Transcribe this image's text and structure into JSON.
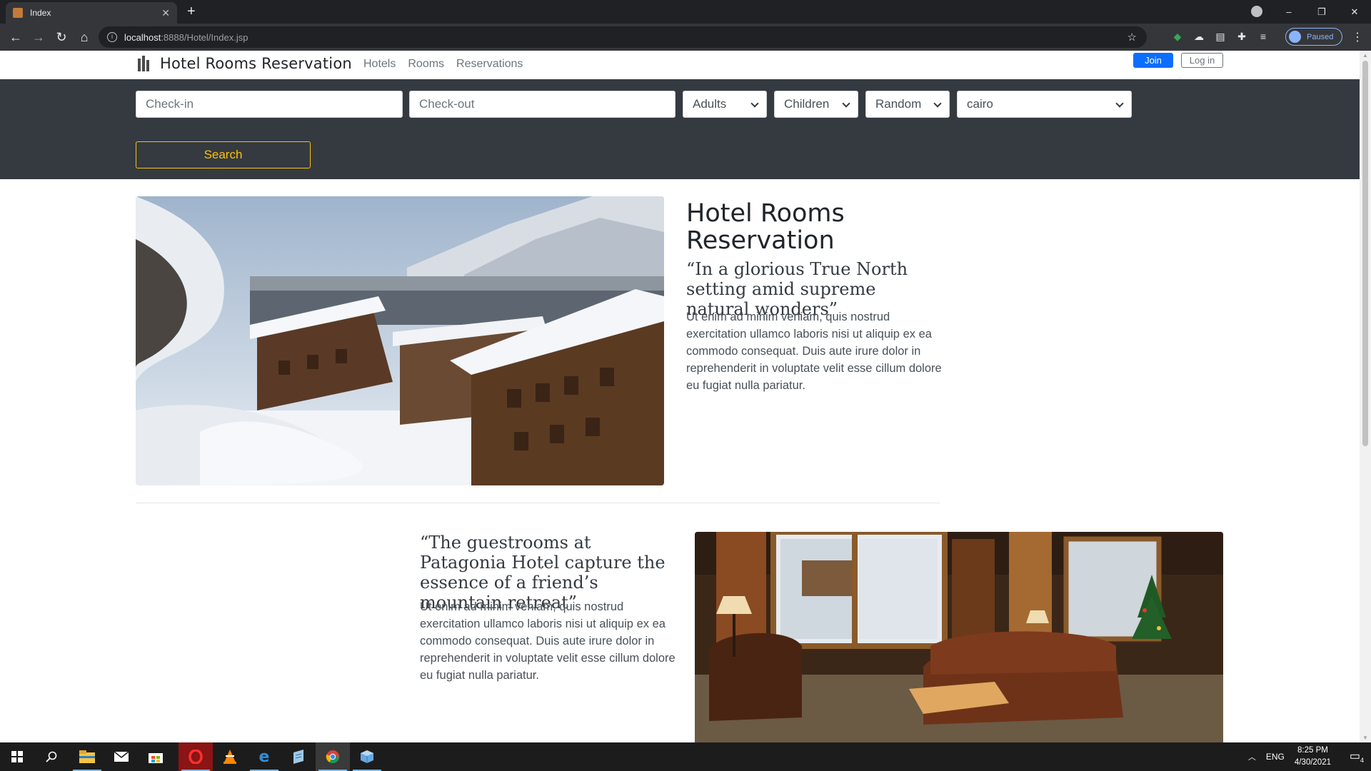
{
  "browser": {
    "tab_title": "Index",
    "new_tab": "+",
    "close_tab": "✕",
    "url_host": "localhost",
    "url_rest": ":8888/Hotel/Index.jsp",
    "profile_status": "Paused",
    "window_controls": {
      "minimize": "–",
      "restore": "❐",
      "close": "✕"
    },
    "nav": {
      "back": "←",
      "forward": "→",
      "reload": "↻",
      "home": "⌂"
    }
  },
  "site": {
    "brand": "Hotel Rooms Reservation",
    "nav_links": [
      "Hotels",
      "Rooms",
      "Reservations"
    ],
    "join_label": "Join",
    "login_label": "Log in"
  },
  "search": {
    "checkin_placeholder": "Check-in",
    "checkout_placeholder": "Check-out",
    "adults": "Adults",
    "children": "Children",
    "sort": "Random",
    "city": "cairo",
    "button": "Search"
  },
  "features": [
    {
      "title": "Hotel Rooms Reservation",
      "quote": "“In a glorious True North setting amid supreme natural wonders”",
      "body": "Ut enim ad minim veniam, quis nostrud exercitation ullamco laboris nisi ut aliquip ex ea commodo consequat. Duis aute irure dolor in reprehenderit in voluptate velit esse cillum dolore eu fugiat nulla pariatur.",
      "image": "snowy-alpine-village-photo"
    },
    {
      "quote": "“The guestrooms at Patagonia Hotel capture the essence of a friend’s mountain retreat”",
      "body": "Ut enim ad minim veniam, quis nostrud exercitation ullamco laboris nisi ut aliquip ex ea commodo consequat. Duis aute irure dolor in reprehenderit in voluptate velit esse cillum dolore eu fugiat nulla pariatur.",
      "image": "cabin-living-room-photo"
    }
  ],
  "taskbar": {
    "apps": [
      "windows-start-icon",
      "search-icon",
      "file-explorer-icon",
      "mail-icon",
      "store-icon",
      "opera-icon",
      "vlc-icon",
      "edge-icon",
      "notepad-icon",
      "chrome-icon",
      "virtualbox-icon"
    ],
    "language": "ENG",
    "time": "8:25 PM",
    "date": "4/30/2021",
    "notifications": "4"
  },
  "colors": {
    "search_band": "#343a40",
    "search_button": "#ffc107",
    "join_button": "#0d6efd"
  }
}
